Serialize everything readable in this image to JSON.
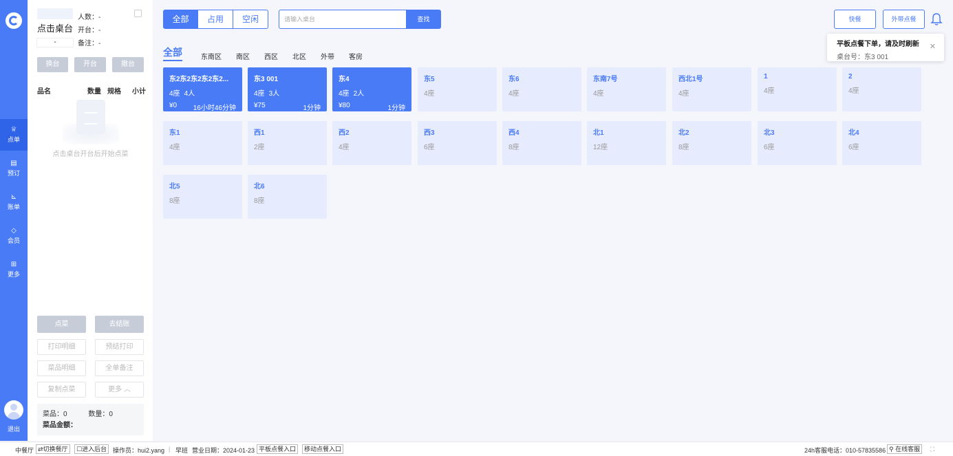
{
  "nav": {
    "items": [
      {
        "label": "点单",
        "icon": "crown-icon"
      },
      {
        "label": "预订",
        "icon": "book-icon"
      },
      {
        "label": "账单",
        "icon": "chart-icon"
      },
      {
        "label": "会员",
        "icon": "diamond-icon"
      },
      {
        "label": "更多",
        "icon": "grid-icon"
      }
    ],
    "logout": "退出"
  },
  "order_panel": {
    "table_name": "点击桌台",
    "table_dash": "-",
    "guests": "人数：-",
    "opened": "开台：-",
    "remark": "备注：-",
    "actions": [
      "换台",
      "开台",
      "撤台"
    ],
    "columns": [
      "品名",
      "数量",
      "规格",
      "小计"
    ],
    "empty_text": "点击桌台开台后开始点菜",
    "buttons": {
      "order": "点菜",
      "checkout": "去结账",
      "print_detail": "打印明细",
      "pre_print": "预结打印",
      "dish_detail": "菜品明细",
      "whole_note": "全单备注",
      "copy_dishes": "复制点菜",
      "more": "更多 ︿"
    },
    "summary": {
      "dishes": "菜品：0",
      "quantity": "数量：0",
      "amount": "菜品金额："
    }
  },
  "filter": {
    "tabs": [
      "全部",
      "占用",
      "空闲"
    ],
    "active_tab": "全部",
    "search_placeholder": "请输入桌台",
    "search_button": "查找"
  },
  "top_actions": {
    "quick": "快餐",
    "takeout": "外带点餐"
  },
  "zones": [
    "全部",
    "东南区",
    "南区",
    "西区",
    "北区",
    "外带",
    "客房"
  ],
  "tables": [
    {
      "name": "东2东2东2东2东2...",
      "seats": "4座",
      "people": "4人",
      "amount": "¥0",
      "duration": "16小时46分钟",
      "occupied": true
    },
    {
      "name": "东3 001",
      "seats": "4座",
      "people": "3人",
      "amount": "¥75",
      "duration": "1分钟",
      "occupied": true
    },
    {
      "name": "东4",
      "seats": "4座",
      "people": "2人",
      "amount": "¥80",
      "duration": "1分钟",
      "occupied": true
    },
    {
      "name": "东5",
      "seats": "4座"
    },
    {
      "name": "东6",
      "seats": "4座"
    },
    {
      "name": "东南7号",
      "seats": "4座"
    },
    {
      "name": "西北1号",
      "seats": "4座"
    },
    {
      "name": "1",
      "seats": "4座"
    },
    {
      "name": "2",
      "seats": "4座"
    },
    {
      "name": "东1",
      "seats": "4座"
    },
    {
      "name": "西1",
      "seats": "2座"
    },
    {
      "name": "西2",
      "seats": "4座"
    },
    {
      "name": "西3",
      "seats": "6座"
    },
    {
      "name": "西4",
      "seats": "8座"
    },
    {
      "name": "北1",
      "seats": "12座"
    },
    {
      "name": "北2",
      "seats": "8座"
    },
    {
      "name": "北3",
      "seats": "6座"
    },
    {
      "name": "北4",
      "seats": "6座"
    },
    {
      "name": "北5",
      "seats": "8座"
    },
    {
      "name": "北6",
      "seats": "8座"
    }
  ],
  "toast": {
    "title": "平板点餐下单，请及时刷新",
    "body": "桌台号：东3 001",
    "close": "✕"
  },
  "statusbar": {
    "restaurant": "中餐厅",
    "switch": "⇄切换餐厅",
    "backend": "☐进入后台",
    "operator": "操作员：hui2.yang",
    "sep": "|",
    "shift": "早班",
    "business_date": "营业日期：2024-01-23",
    "tablet_entry": "平板点餐入口",
    "mobile_entry": "移动点餐入口",
    "hotline": "24h客服电话：010-57835586",
    "online": "⚲ 在线客服",
    "fullscreen": "⛶"
  },
  "colors": {
    "primary": "#4a7bf7",
    "card_idle": "#e6ebfd",
    "disabled_btn": "#c6cdd9"
  }
}
